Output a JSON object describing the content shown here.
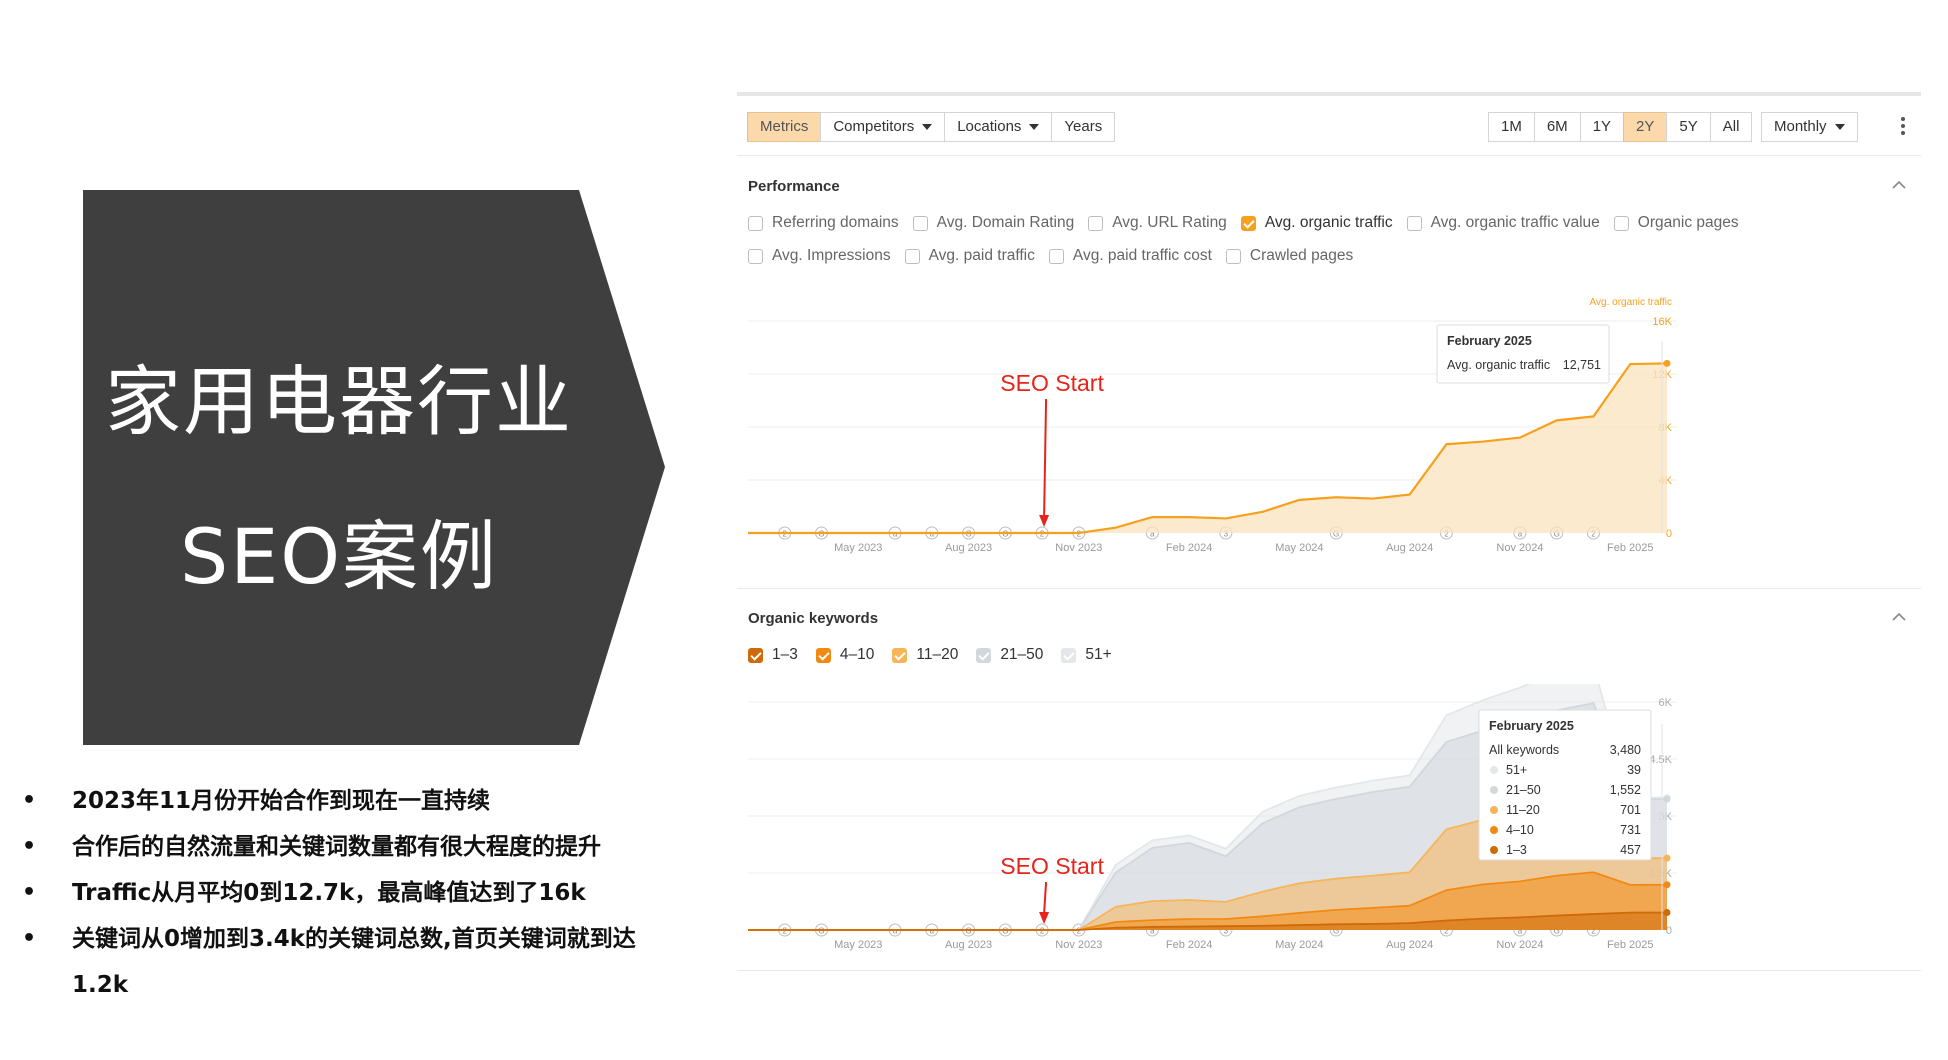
{
  "hero": {
    "line1": "家用电器行业",
    "line2": "SEO案例",
    "bg_color": "#3f3f3f"
  },
  "bullets": [
    "2023年11月份开始合作到现在一直持续",
    "合作后的自然流量和关键词数量都有很大程度的提升",
    "Traffic从月平均0到12.7k，最高峰值达到了16k",
    "关键词从0增加到3.4k的关键词总数,首页关键词就到达1.2k"
  ],
  "toolbar": {
    "left_tabs": [
      {
        "label": "Metrics",
        "active": true,
        "dropdown": false
      },
      {
        "label": "Competitors",
        "active": false,
        "dropdown": true
      },
      {
        "label": "Locations",
        "active": false,
        "dropdown": true
      },
      {
        "label": "Years",
        "active": false,
        "dropdown": false
      }
    ],
    "ranges": [
      {
        "label": "1M",
        "active": false
      },
      {
        "label": "6M",
        "active": false
      },
      {
        "label": "1Y",
        "active": false
      },
      {
        "label": "2Y",
        "active": true
      },
      {
        "label": "5Y",
        "active": false
      },
      {
        "label": "All",
        "active": false
      }
    ],
    "interval": "Monthly",
    "menu_icon": "kebab-menu-icon"
  },
  "performance": {
    "title": "Performance",
    "metrics_row1": [
      {
        "label": "Referring domains",
        "checked": false
      },
      {
        "label": "Avg. Domain Rating",
        "checked": false
      },
      {
        "label": "Avg. URL Rating",
        "checked": false
      },
      {
        "label": "Avg. organic traffic",
        "checked": true
      },
      {
        "label": "Avg. organic traffic value",
        "checked": false
      },
      {
        "label": "Organic pages",
        "checked": false
      }
    ],
    "metrics_row2": [
      {
        "label": "Avg. Impressions",
        "checked": false
      },
      {
        "label": "Avg. paid traffic",
        "checked": false
      },
      {
        "label": "Avg. paid traffic cost",
        "checked": false
      },
      {
        "label": "Crawled pages",
        "checked": false
      }
    ]
  },
  "organic_keywords": {
    "title": "Organic keywords",
    "filters": [
      {
        "label": "1–3",
        "checked": true,
        "color": "#cf6a08"
      },
      {
        "label": "4–10",
        "checked": true,
        "color": "#f28a12"
      },
      {
        "label": "11–20",
        "checked": true,
        "color": "#f7b55a"
      },
      {
        "label": "21–50",
        "checked": true,
        "color": "#d2d7dc"
      },
      {
        "label": "51+",
        "checked": true,
        "color": "#e4e7ea"
      }
    ]
  },
  "chart_data": [
    {
      "type": "area",
      "series_label": "Avg. organic traffic",
      "x_ticks": [
        "May 2023",
        "Aug 2023",
        "Nov 2023",
        "Feb 2024",
        "May 2024",
        "Aug 2024",
        "Nov 2024",
        "Feb 2025"
      ],
      "y_ticks": [
        "0",
        "4K",
        "8K",
        "12K",
        "16K"
      ],
      "ylim": [
        0,
        16000
      ],
      "x": [
        "2023-02",
        "2023-03",
        "2023-04",
        "2023-05",
        "2023-06",
        "2023-07",
        "2023-08",
        "2023-09",
        "2023-10",
        "2023-11",
        "2023-12",
        "2024-01",
        "2024-02",
        "2024-03",
        "2024-04",
        "2024-05",
        "2024-06",
        "2024-07",
        "2024-08",
        "2024-09",
        "2024-10",
        "2024-11",
        "2024-12",
        "2025-01",
        "2025-02",
        "2025-03"
      ],
      "values": [
        0,
        0,
        0,
        0,
        0,
        0,
        0,
        0,
        0,
        0,
        400,
        1200,
        1200,
        1100,
        1600,
        2500,
        2700,
        2600,
        2900,
        6700,
        6900,
        7200,
        8500,
        8800,
        12751,
        12800
      ],
      "annotation": "SEO Start",
      "annotation_x": "2023-10",
      "tooltip": {
        "title": "February 2025",
        "label": "Avg. organic traffic",
        "value": "12,751"
      },
      "markers": [
        "2",
        "G",
        "a",
        "a",
        "G",
        "G",
        "2",
        "2",
        "a",
        "3",
        "G",
        "2",
        "a",
        "G",
        "2"
      ],
      "line_color": "#f5a11e"
    },
    {
      "type": "area",
      "x_ticks": [
        "May 2023",
        "Aug 2023",
        "Nov 2023",
        "Feb 2024",
        "May 2024",
        "Aug 2024",
        "Nov 2024",
        "Feb 2025"
      ],
      "y_ticks": [
        "0",
        "1.5K",
        "3K",
        "4.5K",
        "6K"
      ],
      "ylim": [
        0,
        6000
      ],
      "x": [
        "2023-02",
        "2023-03",
        "2023-04",
        "2023-05",
        "2023-06",
        "2023-07",
        "2023-08",
        "2023-09",
        "2023-10",
        "2023-11",
        "2023-12",
        "2024-01",
        "2024-02",
        "2024-03",
        "2024-04",
        "2024-05",
        "2024-06",
        "2024-07",
        "2024-08",
        "2024-09",
        "2024-10",
        "2024-11",
        "2024-12",
        "2025-01",
        "2025-02",
        "2025-03"
      ],
      "series": [
        {
          "name": "1–3",
          "color": "#cf6a08",
          "values": [
            0,
            0,
            0,
            0,
            0,
            0,
            0,
            0,
            0,
            0,
            60,
            80,
            90,
            100,
            110,
            130,
            150,
            160,
            180,
            250,
            300,
            330,
            380,
            420,
            457,
            460
          ]
        },
        {
          "name": "4–10",
          "color": "#f28a12",
          "values": [
            0,
            0,
            0,
            0,
            0,
            0,
            0,
            0,
            0,
            0,
            150,
            180,
            200,
            190,
            250,
            320,
            380,
            420,
            460,
            800,
            900,
            950,
            1050,
            1100,
            731,
            731
          ]
        },
        {
          "name": "11–20",
          "color": "#f7b55a",
          "values": [
            0,
            0,
            0,
            0,
            0,
            0,
            0,
            0,
            0,
            0,
            400,
            500,
            500,
            450,
            650,
            780,
            820,
            850,
            880,
            1600,
            1700,
            1800,
            1900,
            1950,
            701,
            701
          ]
        },
        {
          "name": "21–50",
          "color": "#d2d7dc",
          "values": [
            0,
            0,
            0,
            0,
            0,
            0,
            0,
            0,
            0,
            0,
            900,
            1400,
            1500,
            1200,
            1800,
            2000,
            2100,
            2200,
            2250,
            2300,
            2350,
            2400,
            2450,
            2500,
            1552,
            1552
          ]
        },
        {
          "name": "51+",
          "color": "#e4e7ea",
          "values": [
            0,
            0,
            0,
            0,
            0,
            0,
            0,
            0,
            0,
            0,
            200,
            200,
            200,
            200,
            300,
            300,
            300,
            300,
            300,
            700,
            800,
            900,
            1000,
            1000,
            39,
            39
          ]
        }
      ],
      "annotation": "SEO Start",
      "annotation_x": "2023-10",
      "tooltip": {
        "title": "February 2025",
        "rows": [
          {
            "label": "All keywords",
            "value": "3,480",
            "color": ""
          },
          {
            "label": "51+",
            "value": "39",
            "color": "#e4e7ea"
          },
          {
            "label": "21–50",
            "value": "1,552",
            "color": "#d2d7dc"
          },
          {
            "label": "11–20",
            "value": "701",
            "color": "#f7b55a"
          },
          {
            "label": "4–10",
            "value": "731",
            "color": "#f28a12"
          },
          {
            "label": "1–3",
            "value": "457",
            "color": "#cf6a08"
          }
        ]
      },
      "markers": [
        "2",
        "G",
        "a",
        "a",
        "G",
        "G",
        "2",
        "2",
        "a",
        "3",
        "G",
        "2",
        "a",
        "G",
        "2"
      ]
    }
  ]
}
